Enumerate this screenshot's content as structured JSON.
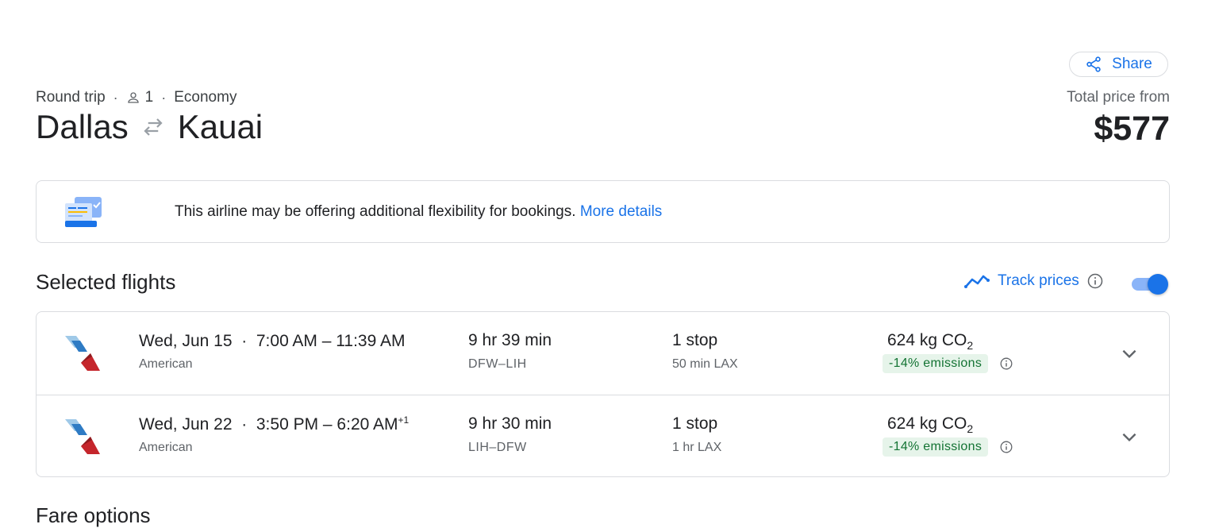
{
  "header": {
    "share_label": "Share",
    "trip_type": "Round trip",
    "sep": "·",
    "passengers": "1",
    "cabin": "Economy",
    "origin": "Dallas",
    "destination": "Kauai",
    "price_label": "Total price from",
    "price": "$577"
  },
  "banner": {
    "text": "This airline may be offering additional flexibility for bookings.",
    "link": "More details"
  },
  "selected": {
    "title": "Selected flights",
    "track_label": "Track prices",
    "track_enabled": true
  },
  "flights": [
    {
      "date": "Wed, Jun 15",
      "sep": "·",
      "times": "7:00 AM – 11:39 AM",
      "day_offset": "",
      "airline": "American",
      "duration": "9 hr 39 min",
      "route": "DFW–LIH",
      "stops": "1 stop",
      "layover": "50 min LAX",
      "co2": "624 kg CO",
      "co2_sub": "2",
      "emissions": "-14% emissions"
    },
    {
      "date": "Wed, Jun 22",
      "sep": "·",
      "times": "3:50 PM – 6:20 AM",
      "day_offset": "+1",
      "airline": "American",
      "duration": "9 hr 30 min",
      "route": "LIH–DFW",
      "stops": "1 stop",
      "layover": "1 hr LAX",
      "co2": "624 kg CO",
      "co2_sub": "2",
      "emissions": "-14% emissions"
    }
  ],
  "fare_title": "Fare options",
  "colors": {
    "accent": "#1a73e8",
    "emissions_bg": "#e6f4ea",
    "emissions_text": "#137333"
  }
}
